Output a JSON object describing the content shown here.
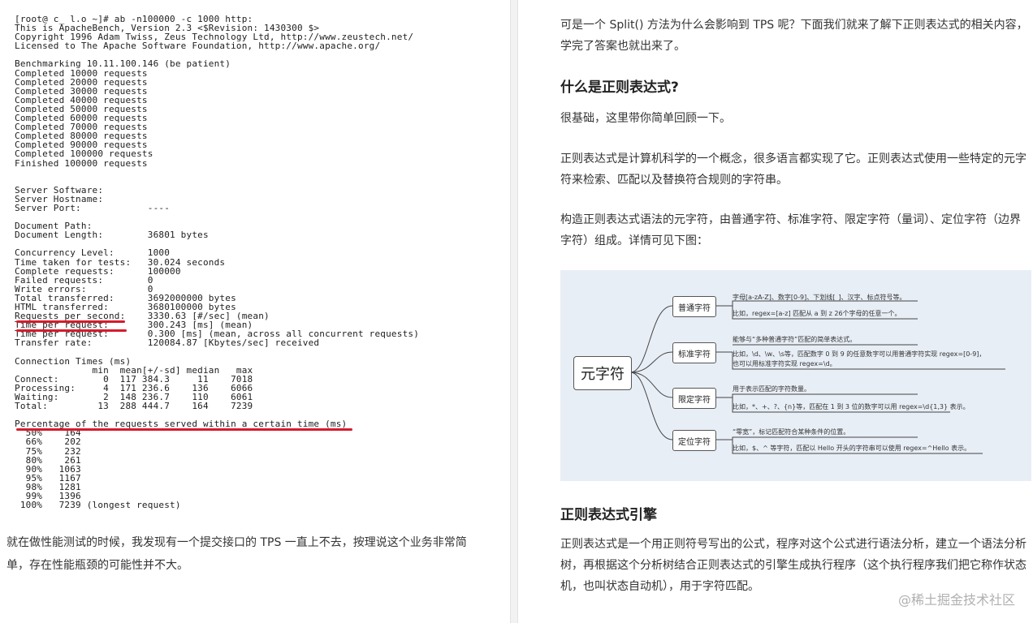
{
  "terminal": {
    "lines": [
      "[root@ c_ l.o ~]# ab -n100000 -c 1000 http:",
      "This is ApacheBench, Version 2.3 <$Revision: 1430300 $>",
      "Copyright 1996 Adam Twiss, Zeus Technology Ltd, http://www.zeustech.net/",
      "Licensed to The Apache Software Foundation, http://www.apache.org/",
      "",
      "Benchmarking 10.11.100.146 (be patient)",
      "Completed 10000 requests",
      "Completed 20000 requests",
      "Completed 30000 requests",
      "Completed 40000 requests",
      "Completed 50000 requests",
      "Completed 60000 requests",
      "Completed 70000 requests",
      "Completed 80000 requests",
      "Completed 90000 requests",
      "Completed 100000 requests",
      "Finished 100000 requests",
      "",
      "",
      "Server Software:",
      "Server Hostname:",
      "Server Port:            ----",
      "",
      "Document Path:",
      "Document Length:        36801 bytes",
      "",
      "Concurrency Level:      1000",
      "Time taken for tests:   30.024 seconds",
      "Complete requests:      100000",
      "Failed requests:        0",
      "Write errors:           0",
      "Total transferred:      3692000000 bytes",
      "HTML transferred:       3680100000 bytes",
      "Requests per second:    3330.63 [#/sec] (mean)",
      "Time per request:       300.243 [ms] (mean)",
      "Time per request:       0.300 [ms] (mean, across all concurrent requests)",
      "Transfer rate:          120084.87 [Kbytes/sec] received",
      "",
      "Connection Times (ms)",
      "              min  mean[+/-sd] median   max",
      "Connect:        0  117 384.3     11    7018",
      "Processing:     4  171 236.6    136    6066",
      "Waiting:        2  148 236.7    110    6061",
      "Total:         13  288 444.7    164    7239",
      "",
      "Percentage of the requests served within a certain time (ms)",
      "  50%    164",
      "  66%    202",
      "  75%    232",
      "  80%    261",
      "  90%   1063",
      "  95%   1167",
      "  98%   1281",
      "  99%   1396",
      " 100%   7239 (longest request)"
    ]
  },
  "left": {
    "paragraph": "就在做性能测试的时候，我发现有一个提交接口的 TPS 一直上不去，按理说这个业务非常简单，存在性能瓶颈的可能性并不大。"
  },
  "right": {
    "intro": "可是一个 Split() 方法为什么会影响到 TPS 呢？下面我们就来了解下正则表达式的相关内容，学完了答案也就出来了。",
    "h1": "什么是正则表达式?",
    "p1": "很基础，这里带你简单回顾一下。",
    "p2": "正则表达式是计算机科学的一个概念，很多语言都实现了它。正则表达式使用一些特定的元字符来检索、匹配以及替换符合规则的字符串。",
    "p3": "构造正则表达式语法的元字符，由普通字符、标准字符、限定字符（量词）、定位字符（边界字符）组成。详情可见下图：",
    "h2": "正则表达式引擎",
    "p4": "正则表达式是一个用正则符号写出的公式，程序对这个公式进行语法分析，建立一个语法分析树，再根据这个分析树结合正则表达式的引擎生成执行程序（这个执行程序我们把它称作状态机，也叫状态自动机），用于字符匹配。"
  },
  "mindmap": {
    "root": "元字符",
    "branches": [
      {
        "label": "普通字符",
        "leaves": [
          "字母[a-zA-Z]、数字[0-9]、下划线[_]、汉字、标点符号等。",
          "比如，regex=[a-z] 匹配从 a 到 z 26个字母的任意一个。"
        ]
      },
      {
        "label": "标准字符",
        "leaves": [
          "能够与“多种普通字符”匹配的简单表达式。",
          "比如，\\d、\\w、\\s等，匹配数字 0 到 9 的任意数字可以用普通字符实现 regex=[0-9]，",
          "也可以用标准字符实现 regex=\\d。"
        ]
      },
      {
        "label": "限定字符",
        "leaves": [
          "用于表示匹配的字符数量。",
          "比如，*、+、?、{n}等，匹配在 1 到 3 位的数字可以用 regex=\\d{1,3} 表示。"
        ]
      },
      {
        "label": "定位字符",
        "leaves": [
          "“零宽”，标记匹配符合某种条件的位置。",
          "比如，$、^ 等字符，匹配以 Hello 开头的字符串可以使用 regex=^Hello 表示。"
        ]
      }
    ]
  },
  "watermark": "@稀土掘金技术社区",
  "colors": {
    "underline": "#d71b2b",
    "diagram_bg": "#e8eef6"
  }
}
